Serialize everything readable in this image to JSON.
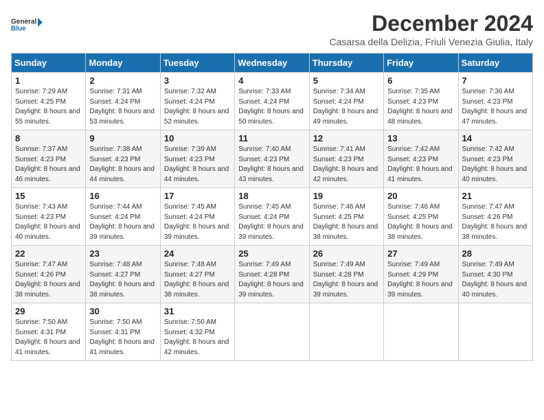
{
  "logo": {
    "line1": "General",
    "line2": "Blue"
  },
  "title": "December 2024",
  "subtitle": "Casarsa della Delizia, Friuli Venezia Giulia, Italy",
  "days_of_week": [
    "Sunday",
    "Monday",
    "Tuesday",
    "Wednesday",
    "Thursday",
    "Friday",
    "Saturday"
  ],
  "weeks": [
    [
      {
        "day": 1,
        "sunrise": "7:29 AM",
        "sunset": "4:25 PM",
        "daylight": "8 hours and 55 minutes."
      },
      {
        "day": 2,
        "sunrise": "7:31 AM",
        "sunset": "4:24 PM",
        "daylight": "8 hours and 53 minutes."
      },
      {
        "day": 3,
        "sunrise": "7:32 AM",
        "sunset": "4:24 PM",
        "daylight": "8 hours and 52 minutes."
      },
      {
        "day": 4,
        "sunrise": "7:33 AM",
        "sunset": "4:24 PM",
        "daylight": "8 hours and 50 minutes."
      },
      {
        "day": 5,
        "sunrise": "7:34 AM",
        "sunset": "4:24 PM",
        "daylight": "8 hours and 49 minutes."
      },
      {
        "day": 6,
        "sunrise": "7:35 AM",
        "sunset": "4:23 PM",
        "daylight": "8 hours and 48 minutes."
      },
      {
        "day": 7,
        "sunrise": "7:36 AM",
        "sunset": "4:23 PM",
        "daylight": "8 hours and 47 minutes."
      }
    ],
    [
      {
        "day": 8,
        "sunrise": "7:37 AM",
        "sunset": "4:23 PM",
        "daylight": "8 hours and 46 minutes."
      },
      {
        "day": 9,
        "sunrise": "7:38 AM",
        "sunset": "4:23 PM",
        "daylight": "8 hours and 44 minutes."
      },
      {
        "day": 10,
        "sunrise": "7:39 AM",
        "sunset": "4:23 PM",
        "daylight": "8 hours and 44 minutes."
      },
      {
        "day": 11,
        "sunrise": "7:40 AM",
        "sunset": "4:23 PM",
        "daylight": "8 hours and 43 minutes."
      },
      {
        "day": 12,
        "sunrise": "7:41 AM",
        "sunset": "4:23 PM",
        "daylight": "8 hours and 42 minutes."
      },
      {
        "day": 13,
        "sunrise": "7:42 AM",
        "sunset": "4:23 PM",
        "daylight": "8 hours and 41 minutes."
      },
      {
        "day": 14,
        "sunrise": "7:42 AM",
        "sunset": "4:23 PM",
        "daylight": "8 hours and 40 minutes."
      }
    ],
    [
      {
        "day": 15,
        "sunrise": "7:43 AM",
        "sunset": "4:23 PM",
        "daylight": "8 hours and 40 minutes."
      },
      {
        "day": 16,
        "sunrise": "7:44 AM",
        "sunset": "4:24 PM",
        "daylight": "8 hours and 39 minutes."
      },
      {
        "day": 17,
        "sunrise": "7:45 AM",
        "sunset": "4:24 PM",
        "daylight": "8 hours and 39 minutes."
      },
      {
        "day": 18,
        "sunrise": "7:45 AM",
        "sunset": "4:24 PM",
        "daylight": "8 hours and 39 minutes."
      },
      {
        "day": 19,
        "sunrise": "7:46 AM",
        "sunset": "4:25 PM",
        "daylight": "8 hours and 38 minutes."
      },
      {
        "day": 20,
        "sunrise": "7:46 AM",
        "sunset": "4:25 PM",
        "daylight": "8 hours and 38 minutes."
      },
      {
        "day": 21,
        "sunrise": "7:47 AM",
        "sunset": "4:26 PM",
        "daylight": "8 hours and 38 minutes."
      }
    ],
    [
      {
        "day": 22,
        "sunrise": "7:47 AM",
        "sunset": "4:26 PM",
        "daylight": "8 hours and 38 minutes."
      },
      {
        "day": 23,
        "sunrise": "7:48 AM",
        "sunset": "4:27 PM",
        "daylight": "8 hours and 38 minutes."
      },
      {
        "day": 24,
        "sunrise": "7:48 AM",
        "sunset": "4:27 PM",
        "daylight": "8 hours and 38 minutes."
      },
      {
        "day": 25,
        "sunrise": "7:49 AM",
        "sunset": "4:28 PM",
        "daylight": "8 hours and 39 minutes."
      },
      {
        "day": 26,
        "sunrise": "7:49 AM",
        "sunset": "4:28 PM",
        "daylight": "8 hours and 39 minutes."
      },
      {
        "day": 27,
        "sunrise": "7:49 AM",
        "sunset": "4:29 PM",
        "daylight": "8 hours and 39 minutes."
      },
      {
        "day": 28,
        "sunrise": "7:49 AM",
        "sunset": "4:30 PM",
        "daylight": "8 hours and 40 minutes."
      }
    ],
    [
      {
        "day": 29,
        "sunrise": "7:50 AM",
        "sunset": "4:31 PM",
        "daylight": "8 hours and 41 minutes."
      },
      {
        "day": 30,
        "sunrise": "7:50 AM",
        "sunset": "4:31 PM",
        "daylight": "8 hours and 41 minutes."
      },
      {
        "day": 31,
        "sunrise": "7:50 AM",
        "sunset": "4:32 PM",
        "daylight": "8 hours and 42 minutes."
      },
      null,
      null,
      null,
      null
    ]
  ]
}
